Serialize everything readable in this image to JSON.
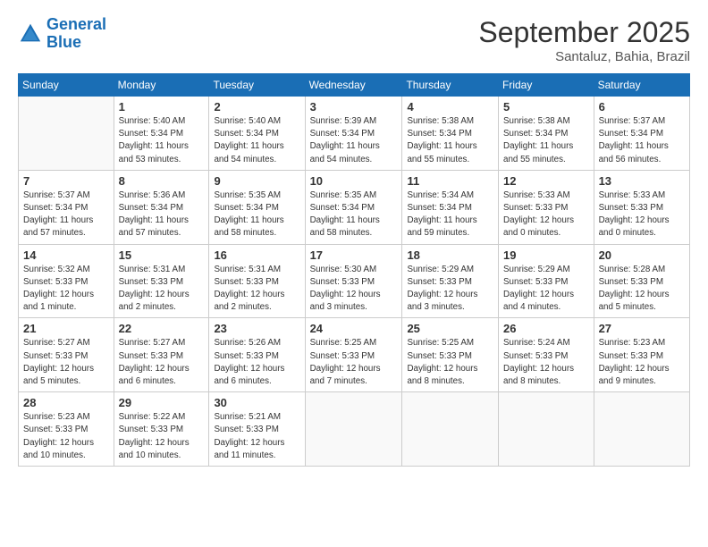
{
  "logo": {
    "line1": "General",
    "line2": "Blue"
  },
  "title": "September 2025",
  "location": "Santaluz, Bahia, Brazil",
  "days_of_week": [
    "Sunday",
    "Monday",
    "Tuesday",
    "Wednesday",
    "Thursday",
    "Friday",
    "Saturday"
  ],
  "weeks": [
    [
      {
        "day": "",
        "info": ""
      },
      {
        "day": "1",
        "info": "Sunrise: 5:40 AM\nSunset: 5:34 PM\nDaylight: 11 hours\nand 53 minutes."
      },
      {
        "day": "2",
        "info": "Sunrise: 5:40 AM\nSunset: 5:34 PM\nDaylight: 11 hours\nand 54 minutes."
      },
      {
        "day": "3",
        "info": "Sunrise: 5:39 AM\nSunset: 5:34 PM\nDaylight: 11 hours\nand 54 minutes."
      },
      {
        "day": "4",
        "info": "Sunrise: 5:38 AM\nSunset: 5:34 PM\nDaylight: 11 hours\nand 55 minutes."
      },
      {
        "day": "5",
        "info": "Sunrise: 5:38 AM\nSunset: 5:34 PM\nDaylight: 11 hours\nand 55 minutes."
      },
      {
        "day": "6",
        "info": "Sunrise: 5:37 AM\nSunset: 5:34 PM\nDaylight: 11 hours\nand 56 minutes."
      }
    ],
    [
      {
        "day": "7",
        "info": "Sunrise: 5:37 AM\nSunset: 5:34 PM\nDaylight: 11 hours\nand 57 minutes."
      },
      {
        "day": "8",
        "info": "Sunrise: 5:36 AM\nSunset: 5:34 PM\nDaylight: 11 hours\nand 57 minutes."
      },
      {
        "day": "9",
        "info": "Sunrise: 5:35 AM\nSunset: 5:34 PM\nDaylight: 11 hours\nand 58 minutes."
      },
      {
        "day": "10",
        "info": "Sunrise: 5:35 AM\nSunset: 5:34 PM\nDaylight: 11 hours\nand 58 minutes."
      },
      {
        "day": "11",
        "info": "Sunrise: 5:34 AM\nSunset: 5:34 PM\nDaylight: 11 hours\nand 59 minutes."
      },
      {
        "day": "12",
        "info": "Sunrise: 5:33 AM\nSunset: 5:33 PM\nDaylight: 12 hours\nand 0 minutes."
      },
      {
        "day": "13",
        "info": "Sunrise: 5:33 AM\nSunset: 5:33 PM\nDaylight: 12 hours\nand 0 minutes."
      }
    ],
    [
      {
        "day": "14",
        "info": "Sunrise: 5:32 AM\nSunset: 5:33 PM\nDaylight: 12 hours\nand 1 minute."
      },
      {
        "day": "15",
        "info": "Sunrise: 5:31 AM\nSunset: 5:33 PM\nDaylight: 12 hours\nand 2 minutes."
      },
      {
        "day": "16",
        "info": "Sunrise: 5:31 AM\nSunset: 5:33 PM\nDaylight: 12 hours\nand 2 minutes."
      },
      {
        "day": "17",
        "info": "Sunrise: 5:30 AM\nSunset: 5:33 PM\nDaylight: 12 hours\nand 3 minutes."
      },
      {
        "day": "18",
        "info": "Sunrise: 5:29 AM\nSunset: 5:33 PM\nDaylight: 12 hours\nand 3 minutes."
      },
      {
        "day": "19",
        "info": "Sunrise: 5:29 AM\nSunset: 5:33 PM\nDaylight: 12 hours\nand 4 minutes."
      },
      {
        "day": "20",
        "info": "Sunrise: 5:28 AM\nSunset: 5:33 PM\nDaylight: 12 hours\nand 5 minutes."
      }
    ],
    [
      {
        "day": "21",
        "info": "Sunrise: 5:27 AM\nSunset: 5:33 PM\nDaylight: 12 hours\nand 5 minutes."
      },
      {
        "day": "22",
        "info": "Sunrise: 5:27 AM\nSunset: 5:33 PM\nDaylight: 12 hours\nand 6 minutes."
      },
      {
        "day": "23",
        "info": "Sunrise: 5:26 AM\nSunset: 5:33 PM\nDaylight: 12 hours\nand 6 minutes."
      },
      {
        "day": "24",
        "info": "Sunrise: 5:25 AM\nSunset: 5:33 PM\nDaylight: 12 hours\nand 7 minutes."
      },
      {
        "day": "25",
        "info": "Sunrise: 5:25 AM\nSunset: 5:33 PM\nDaylight: 12 hours\nand 8 minutes."
      },
      {
        "day": "26",
        "info": "Sunrise: 5:24 AM\nSunset: 5:33 PM\nDaylight: 12 hours\nand 8 minutes."
      },
      {
        "day": "27",
        "info": "Sunrise: 5:23 AM\nSunset: 5:33 PM\nDaylight: 12 hours\nand 9 minutes."
      }
    ],
    [
      {
        "day": "28",
        "info": "Sunrise: 5:23 AM\nSunset: 5:33 PM\nDaylight: 12 hours\nand 10 minutes."
      },
      {
        "day": "29",
        "info": "Sunrise: 5:22 AM\nSunset: 5:33 PM\nDaylight: 12 hours\nand 10 minutes."
      },
      {
        "day": "30",
        "info": "Sunrise: 5:21 AM\nSunset: 5:33 PM\nDaylight: 12 hours\nand 11 minutes."
      },
      {
        "day": "",
        "info": ""
      },
      {
        "day": "",
        "info": ""
      },
      {
        "day": "",
        "info": ""
      },
      {
        "day": "",
        "info": ""
      }
    ]
  ]
}
